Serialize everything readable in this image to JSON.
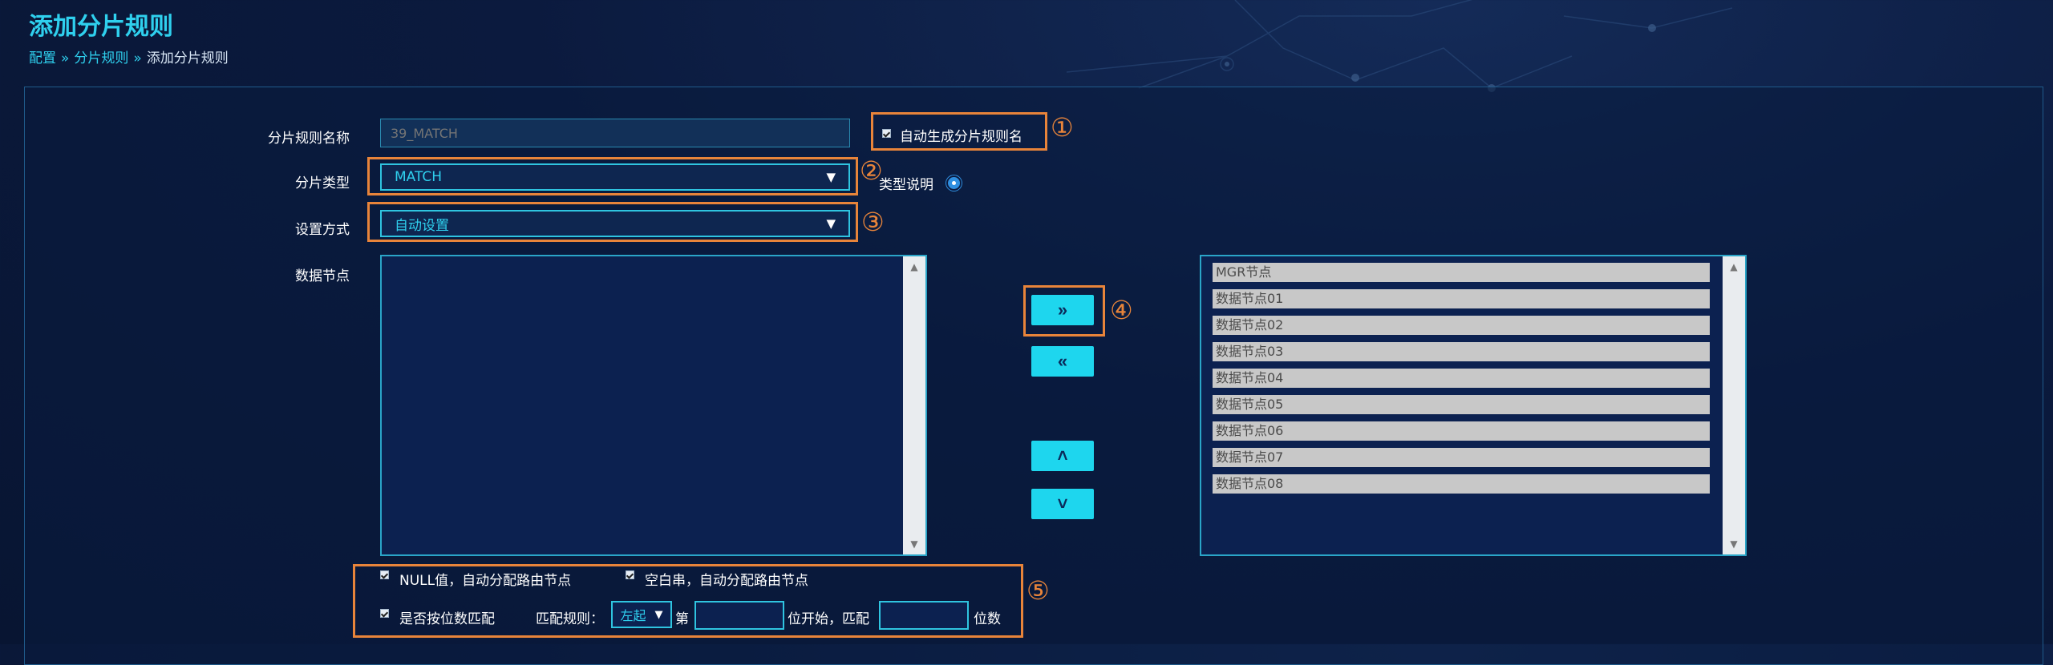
{
  "page": {
    "title": "添加分片规则"
  },
  "breadcrumb": {
    "items": [
      "配置",
      "分片规则",
      "添加分片规则"
    ],
    "separator": "»"
  },
  "form": {
    "rule_name": {
      "label": "分片规则名称",
      "placeholder": "39_MATCH"
    },
    "auto_name": {
      "label": "自动生成分片规则名",
      "checked": true
    },
    "shard_type": {
      "label": "分片类型",
      "value": "MATCH",
      "help_label": "类型说明"
    },
    "set_mode": {
      "label": "设置方式",
      "value": "自动设置"
    },
    "data_nodes": {
      "label": "数据节点",
      "selected": [],
      "available": [
        "MGR节点",
        "数据节点01",
        "数据节点02",
        "数据节点03",
        "数据节点04",
        "数据节点05",
        "数据节点06",
        "数据节点07",
        "数据节点08"
      ]
    },
    "buttons": {
      "move_right": "»",
      "move_left": "«",
      "move_up": "˄",
      "move_down": "˅"
    },
    "options": {
      "null_auto": "NULL值，自动分配路由节点",
      "empty_auto": "空白串，自动分配路由节点",
      "digit_match": "是否按位数匹配",
      "match_rule_label": "匹配规则：",
      "match_rule_value": "左起",
      "nth_label": "第",
      "start_label": "位开始，匹配",
      "digits_label": "位数"
    }
  },
  "annotations": [
    "①",
    "②",
    "③",
    "④",
    "⑤"
  ],
  "colors": {
    "accent": "#1ed6ee",
    "highlight": "#e8843a",
    "background": "#0b1a3e"
  }
}
